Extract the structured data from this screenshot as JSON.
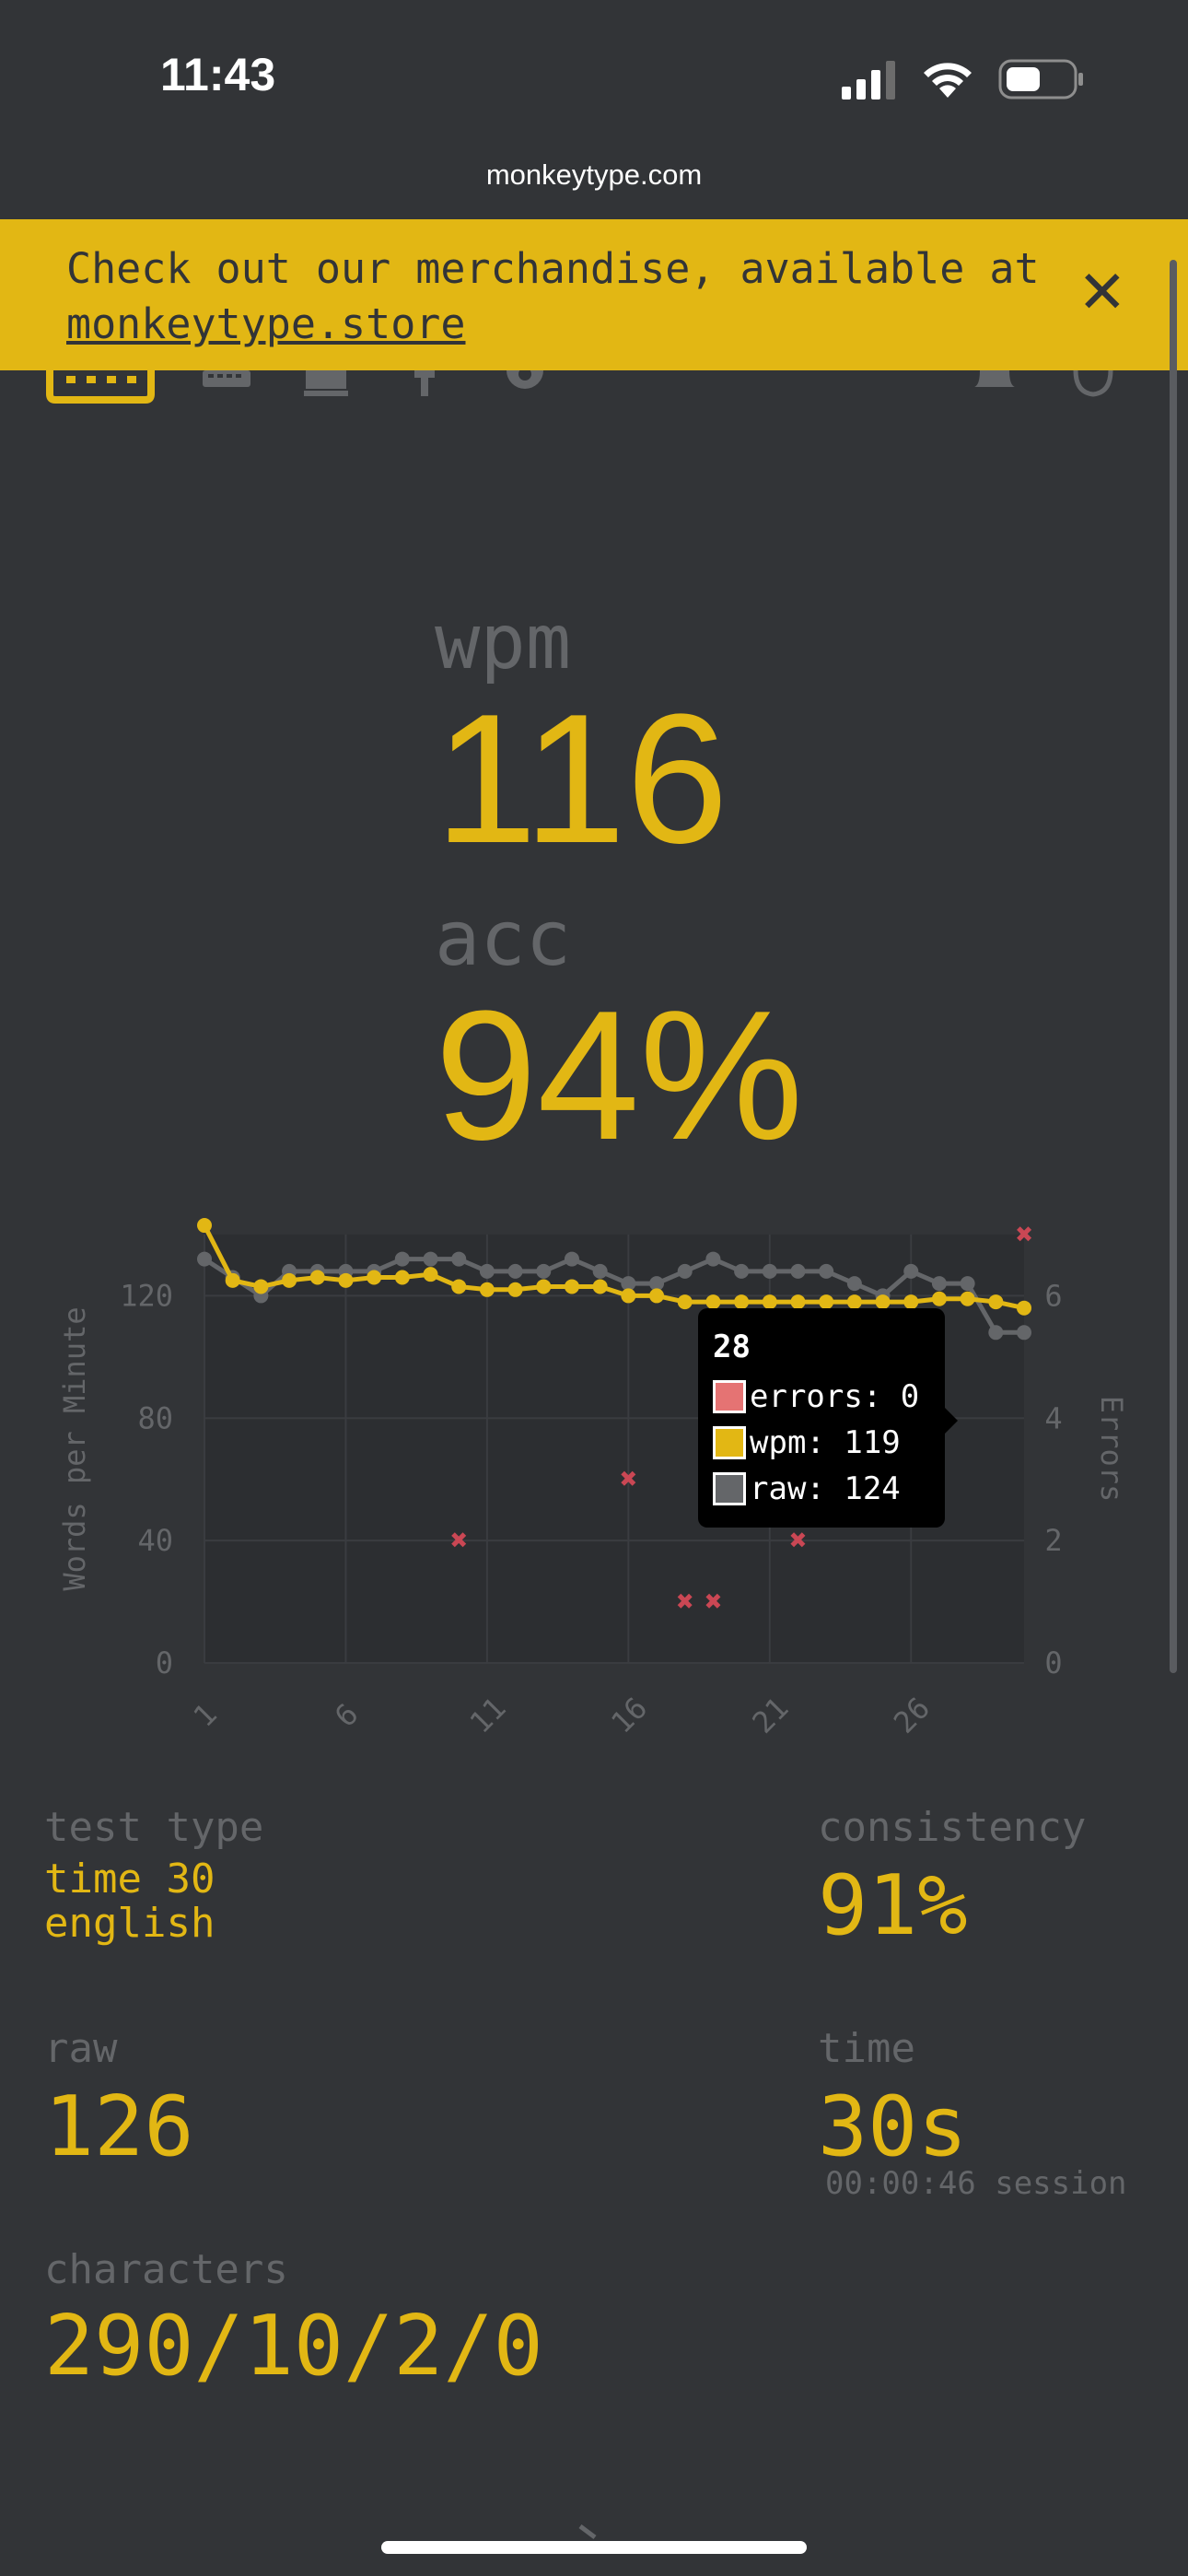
{
  "status_bar": {
    "time": "11:43"
  },
  "browser": {
    "url": "monkeytype.com"
  },
  "banner": {
    "text_before": "Check out our merchandise, available at ",
    "link_text": "monkeytype.store"
  },
  "result": {
    "wpm_label": "wpm",
    "wpm_value": "116",
    "acc_label": "acc",
    "acc_value": "94%"
  },
  "chart_data": {
    "type": "line",
    "x": [
      1,
      2,
      3,
      4,
      5,
      6,
      7,
      8,
      9,
      10,
      11,
      12,
      13,
      14,
      15,
      16,
      17,
      18,
      19,
      20,
      21,
      22,
      23,
      24,
      25,
      26,
      27,
      28,
      29,
      30
    ],
    "xticks": [
      "1",
      "6",
      "11",
      "16",
      "21",
      "26"
    ],
    "ylabel": "Words per Minute",
    "y2label": "Errors",
    "ylim": [
      0,
      140
    ],
    "y2lim": [
      0,
      7
    ],
    "yticks": [
      "0",
      "40",
      "80",
      "120"
    ],
    "y2ticks": [
      "0",
      "2",
      "4",
      "6"
    ],
    "series": [
      {
        "name": "raw",
        "color": "#646669",
        "axis": "y",
        "values": [
          132,
          126,
          120,
          128,
          128,
          128,
          128,
          132,
          132,
          132,
          128,
          128,
          128,
          132,
          128,
          124,
          124,
          128,
          132,
          128,
          128,
          128,
          128,
          124,
          120,
          128,
          124,
          124,
          108,
          108
        ]
      },
      {
        "name": "wpm",
        "color": "#e2b714",
        "axis": "y",
        "values": [
          143,
          125,
          123,
          125,
          126,
          125,
          126,
          126,
          127,
          123,
          122,
          122,
          123,
          123,
          123,
          120,
          120,
          118,
          118,
          118,
          118,
          118,
          118,
          118,
          118,
          118,
          119,
          119,
          118,
          116
        ]
      },
      {
        "name": "errors",
        "color": "#ca4754",
        "axis": "y2",
        "type": "scatter",
        "points": [
          [
            10,
            2
          ],
          [
            16,
            3
          ],
          [
            18,
            1
          ],
          [
            19,
            1
          ],
          [
            22,
            2
          ],
          [
            30,
            7
          ]
        ]
      }
    ]
  },
  "tooltip": {
    "title": "28",
    "errors": "errors: 0",
    "wpm": "wpm: 119",
    "raw": "raw: 124"
  },
  "stats": {
    "test_type_label": "test type",
    "test_type_line1": "time 30",
    "test_type_line2": "english",
    "consistency_label": "consistency",
    "consistency_value": "91%",
    "raw_label": "raw",
    "raw_value": "126",
    "time_label": "time",
    "time_value": "30s",
    "session": "00:00:46 session",
    "characters_label": "characters",
    "characters_value": "290/10/2/0"
  },
  "colors": {
    "accent": "#e2b714",
    "background": "#323437",
    "sub": "#646669",
    "error": "#ca4754"
  }
}
